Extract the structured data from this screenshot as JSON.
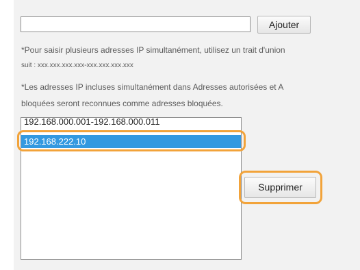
{
  "add_form": {
    "ip_input_value": "",
    "add_button_label": "Ajouter"
  },
  "notes": {
    "range_note_line1": "*Pour saisir plusieurs adresses IP simultanément, utilisez un trait d'union",
    "range_note_line2": "suit : xxx.xxx.xxx.xxx-xxx.xxx.xxx.xxx",
    "overlap_note_line1": "*Les adresses IP incluses simultanément dans Adresses autorisées et A",
    "overlap_note_line2": "bloquées seront reconnues comme adresses bloquées."
  },
  "address_list": {
    "items": [
      {
        "label": "192.168.000.001-192.168.000.011",
        "selected": false
      },
      {
        "label": "192.168.222.10",
        "selected": true
      }
    ]
  },
  "list_actions": {
    "delete_button_label": "Supprimer"
  },
  "colors": {
    "highlight": "#f2a33a",
    "selection": "#3399e0",
    "panel_background": "#f2f2f2"
  }
}
